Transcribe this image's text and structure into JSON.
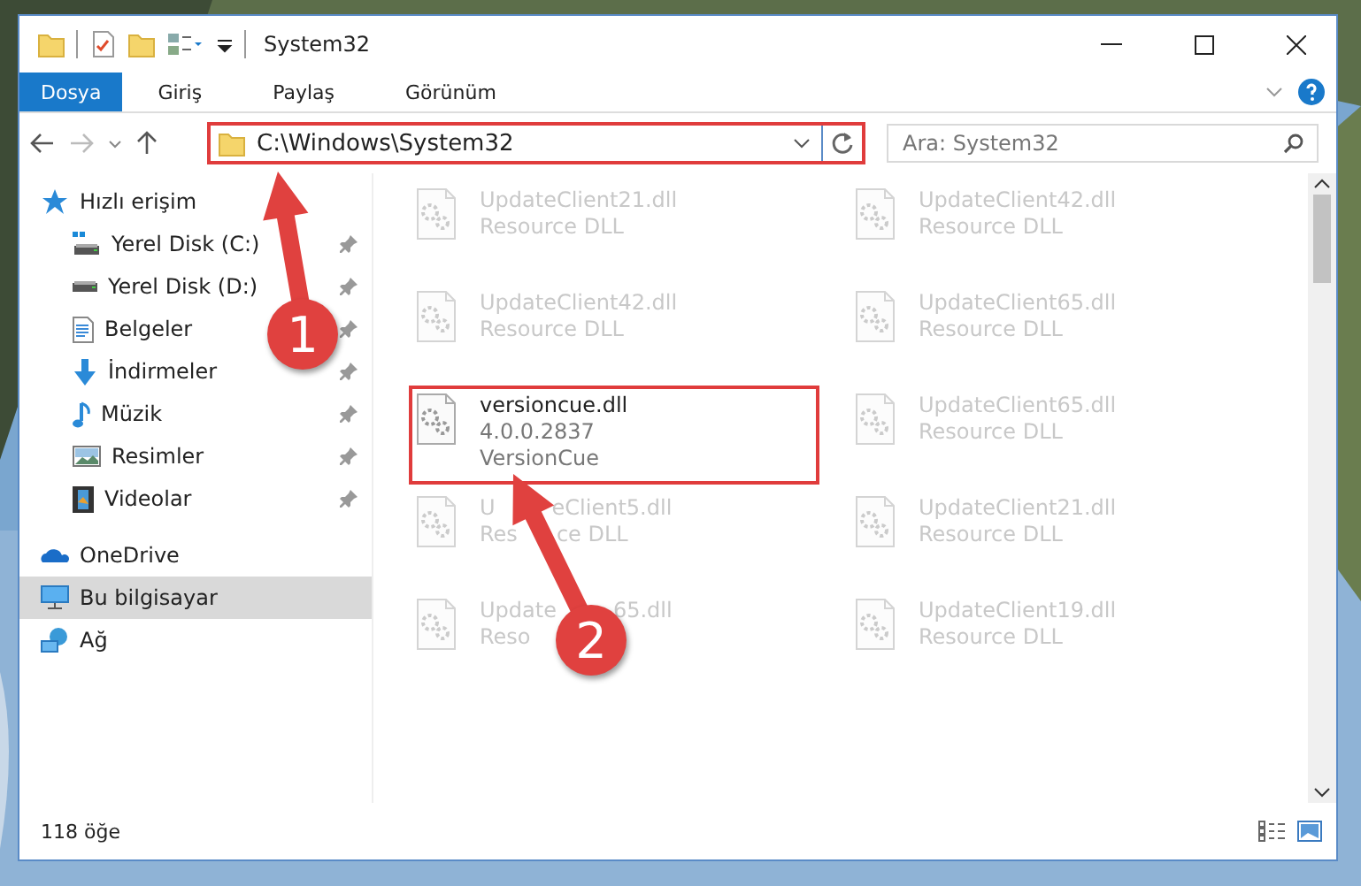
{
  "window": {
    "title": "System32"
  },
  "ribbon": {
    "tabs": [
      {
        "label": "Dosya",
        "selected": true
      },
      {
        "label": "Giriş",
        "selected": false
      },
      {
        "label": "Paylaş",
        "selected": false
      },
      {
        "label": "Görünüm",
        "selected": false
      }
    ]
  },
  "address_bar": {
    "path": "C:\\Windows\\System32",
    "highlighted": true
  },
  "search": {
    "placeholder": "Ara: System32"
  },
  "sidebar": {
    "items": [
      {
        "label": "Hızlı erişim",
        "kind": "star",
        "selected": false,
        "children": [
          {
            "label": "Yerel Disk (C:)",
            "kind": "drive-c",
            "pinned": true
          },
          {
            "label": "Yerel Disk (D:)",
            "kind": "drive",
            "pinned": true
          },
          {
            "label": "Belgeler",
            "kind": "document",
            "pinned": true
          },
          {
            "label": "İndirmeler",
            "kind": "download",
            "pinned": true
          },
          {
            "label": "Müzik",
            "kind": "music",
            "pinned": true
          },
          {
            "label": "Resimler",
            "kind": "pictures",
            "pinned": true
          },
          {
            "label": "Videolar",
            "kind": "video",
            "pinned": true
          }
        ]
      },
      {
        "label": "OneDrive",
        "kind": "cloud",
        "selected": false
      },
      {
        "label": "Bu bilgisayar",
        "kind": "computer",
        "selected": true
      },
      {
        "label": "Ağ",
        "kind": "network",
        "selected": false
      }
    ]
  },
  "files": [
    {
      "name": [
        "UpdateClient21.dll"
      ],
      "details": [
        [
          "Resource DLL"
        ]
      ],
      "blurred": true,
      "highlighted": false
    },
    {
      "name": [
        "UpdateClient42.dll"
      ],
      "details": [
        [
          "Resource DLL"
        ]
      ],
      "blurred": true,
      "highlighted": false
    },
    {
      "name": [
        "UpdateClient42.dll"
      ],
      "details": [
        [
          "Resource DLL"
        ]
      ],
      "blurred": true,
      "highlighted": false
    },
    {
      "name": [
        "UpdateClient65.dll"
      ],
      "details": [
        [
          "Resource DLL"
        ]
      ],
      "blurred": true,
      "highlighted": false
    },
    {
      "name": [
        "versioncue.dll"
      ],
      "details": [
        [
          "4.0.0.2837"
        ],
        [
          "VersionCue"
        ]
      ],
      "blurred": false,
      "highlighted": true
    },
    {
      "name": [
        "UpdateClient65.dll"
      ],
      "details": [
        [
          "Resource DLL"
        ]
      ],
      "blurred": true,
      "highlighted": false
    },
    {
      "name": [
        "U",
        "eClient5.dll"
      ],
      "details": [
        [
          "Res",
          "ce DLL"
        ]
      ],
      "blurred": true,
      "highlighted": false
    },
    {
      "name": [
        "UpdateClient21.dll"
      ],
      "details": [
        [
          "Resource DLL"
        ]
      ],
      "blurred": true,
      "highlighted": false
    },
    {
      "name": [
        "Update",
        "65.dll"
      ],
      "details": [
        [
          "Reso"
        ]
      ],
      "blurred": true,
      "highlighted": false
    },
    {
      "name": [
        "UpdateClient19.dll"
      ],
      "details": [
        [
          "Resource DLL"
        ]
      ],
      "blurred": true,
      "highlighted": false
    }
  ],
  "status_bar": {
    "count": "118 öğe"
  },
  "callouts": [
    {
      "number": "1"
    },
    {
      "number": "2"
    }
  ]
}
